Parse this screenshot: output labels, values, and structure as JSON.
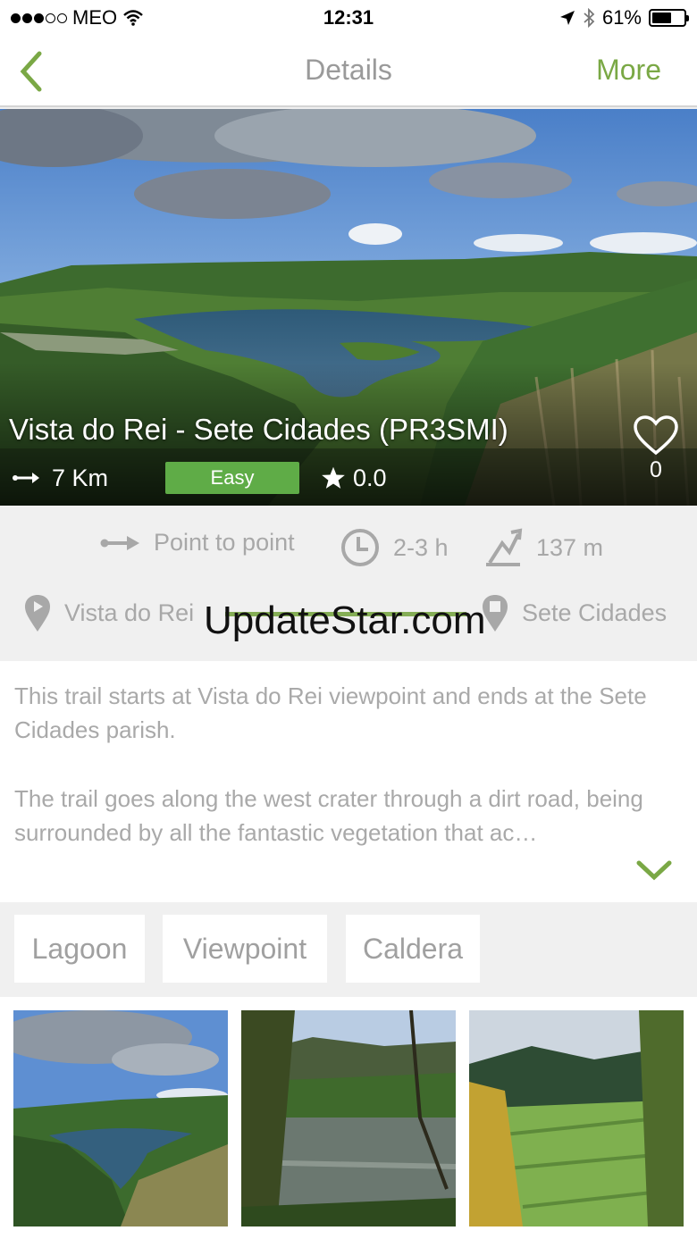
{
  "status_bar": {
    "carrier": "MEO",
    "time": "12:31",
    "battery": "61%",
    "battery_level": 0.61
  },
  "nav": {
    "title": "Details",
    "more_label": "More"
  },
  "trail": {
    "name": "Vista do Rei - Sete Cidades (PR3SMI)",
    "distance": "7 Km",
    "difficulty": "Easy",
    "rating": "0.0",
    "favorites": "0"
  },
  "info": {
    "route_type": "Point to point",
    "duration": "2-3 h",
    "elevation": "137 m",
    "start": "Vista do Rei",
    "end": "Sete Cidades"
  },
  "watermark": "UpdateStar.com",
  "description": {
    "paragraph1": "This trail starts at Vista do Rei viewpoint and ends at the Sete Cidades parish.",
    "paragraph2": "The trail goes along the west crater through a dirt road, being surrounded by all the fantastic vegetation that ac…"
  },
  "tags": [
    "Lagoon",
    "Viewpoint",
    "Caldera"
  ],
  "colors": {
    "accent": "#7aa845",
    "badge": "#5fac47",
    "muted_text": "#a8a8a8"
  }
}
